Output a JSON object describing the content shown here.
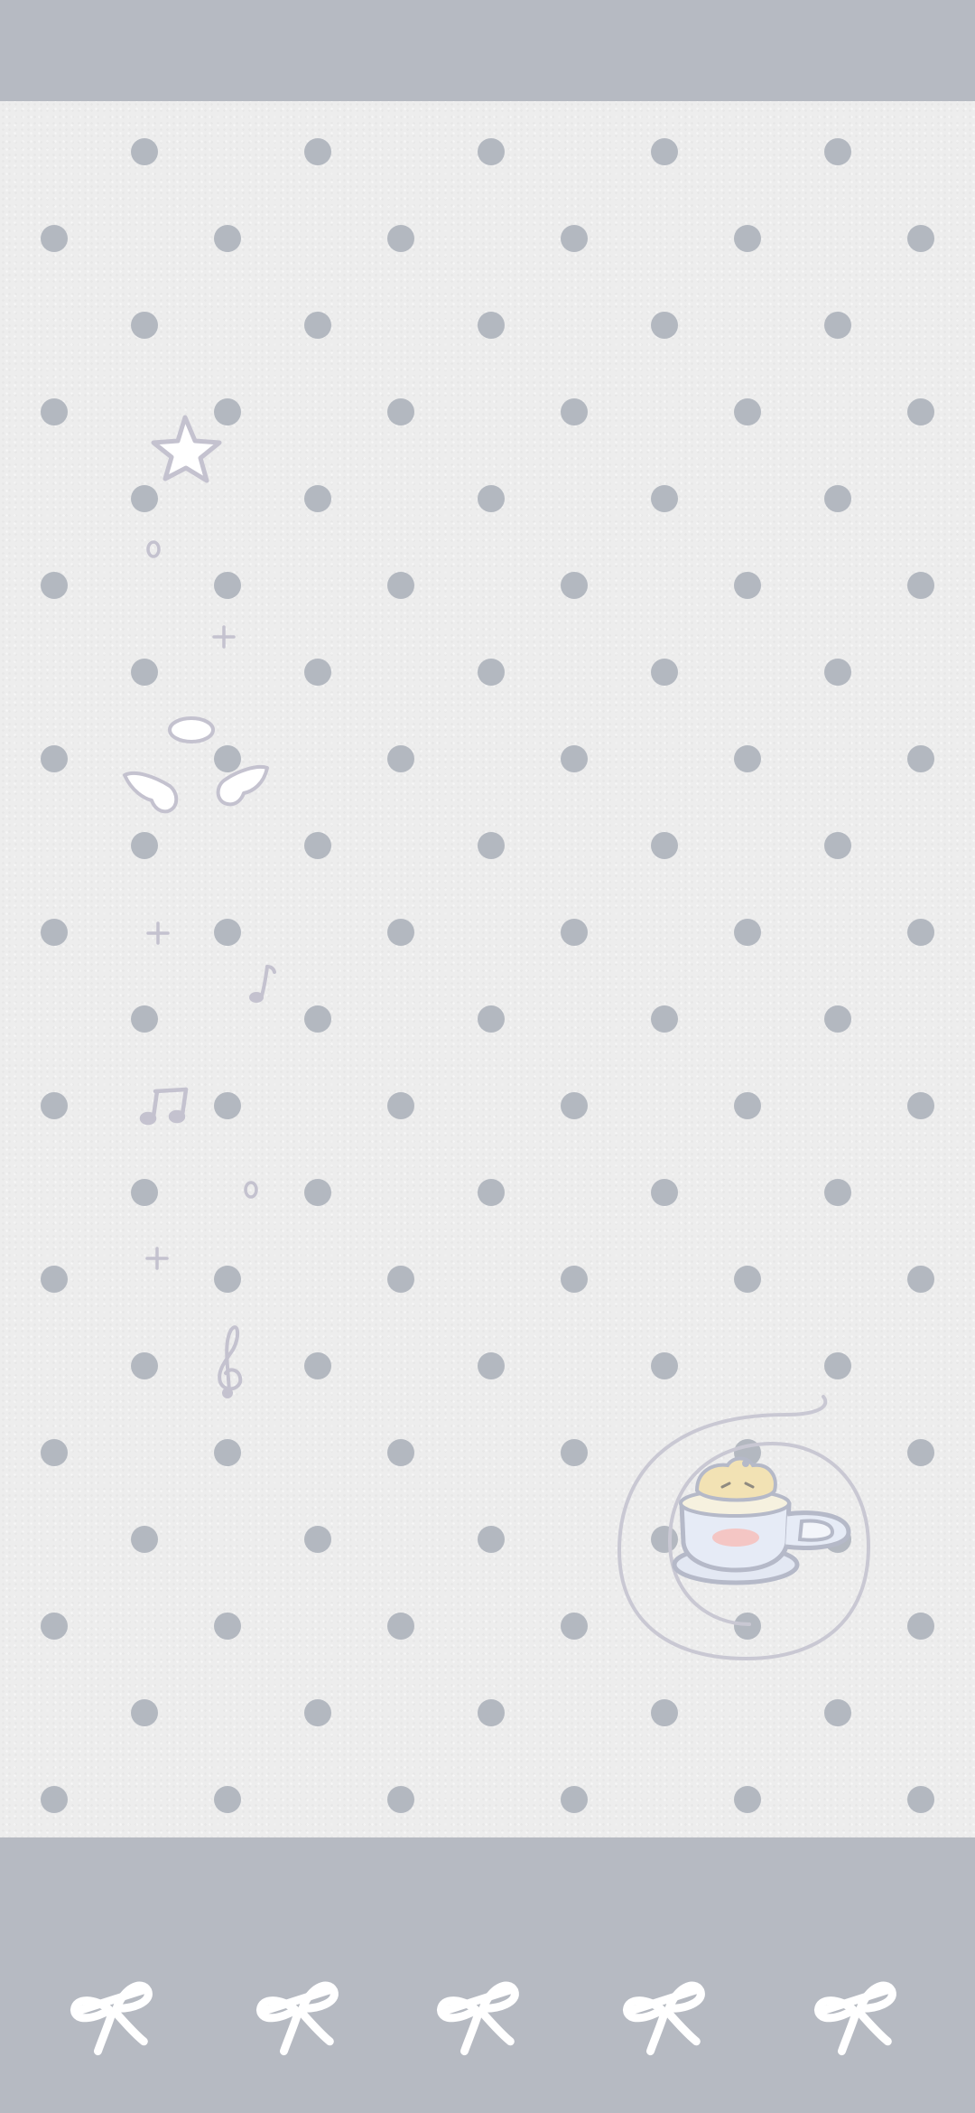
{
  "wallpaper": {
    "colors": {
      "band": "#b6bac2",
      "paper": "#ededed",
      "dot": "#b3b8c0",
      "doodle": "#c4c2cf",
      "bow": "#ffffff"
    },
    "pattern": "polka-dot",
    "doodles": [
      "star-icon",
      "circle-icon",
      "plus-icon",
      "cloud-icon",
      "wings-icon",
      "music-note-icon",
      "beamed-notes-icon",
      "treble-clef-icon",
      "teacup-icon",
      "spiral-icon"
    ],
    "bottom_motif": "bow-icon",
    "bow_count": 5
  }
}
